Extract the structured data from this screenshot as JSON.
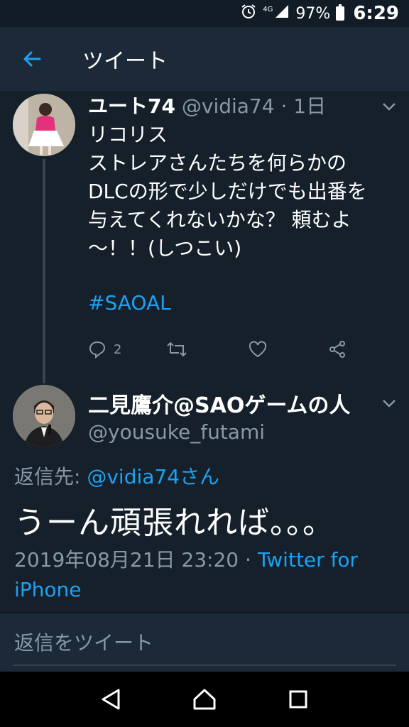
{
  "status": {
    "network": "4G",
    "battery": "97%",
    "time": "6:29"
  },
  "header": {
    "title": "ツイート"
  },
  "tweet1": {
    "name": "ユート74",
    "handle": "@vidia74",
    "dot": " · ",
    "time": "1日",
    "body": "リコリス\nストレアさんたちを何らかの\nDLCの形で少しだけでも出番を\n与えてくれないかな？ 頼むよ\n〜！！(しつこい)",
    "hashtag": "#SAOAL",
    "reply_count": "2"
  },
  "tweet2": {
    "name": "二見鷹介@SAOゲームの人",
    "handle": "@yousuke_futami",
    "reply_label": "返信先: ",
    "reply_target": "@vidia74さん",
    "text": "うーん頑張れれば。。。",
    "date": "2019年08月21日 23:20",
    "dot": " · ",
    "source": "Twitter for iPhone"
  },
  "reply_box": {
    "placeholder": "返信をツイート"
  },
  "colors": {
    "background": "#15202b",
    "accent": "#1da1f2",
    "muted": "#8899a6"
  }
}
